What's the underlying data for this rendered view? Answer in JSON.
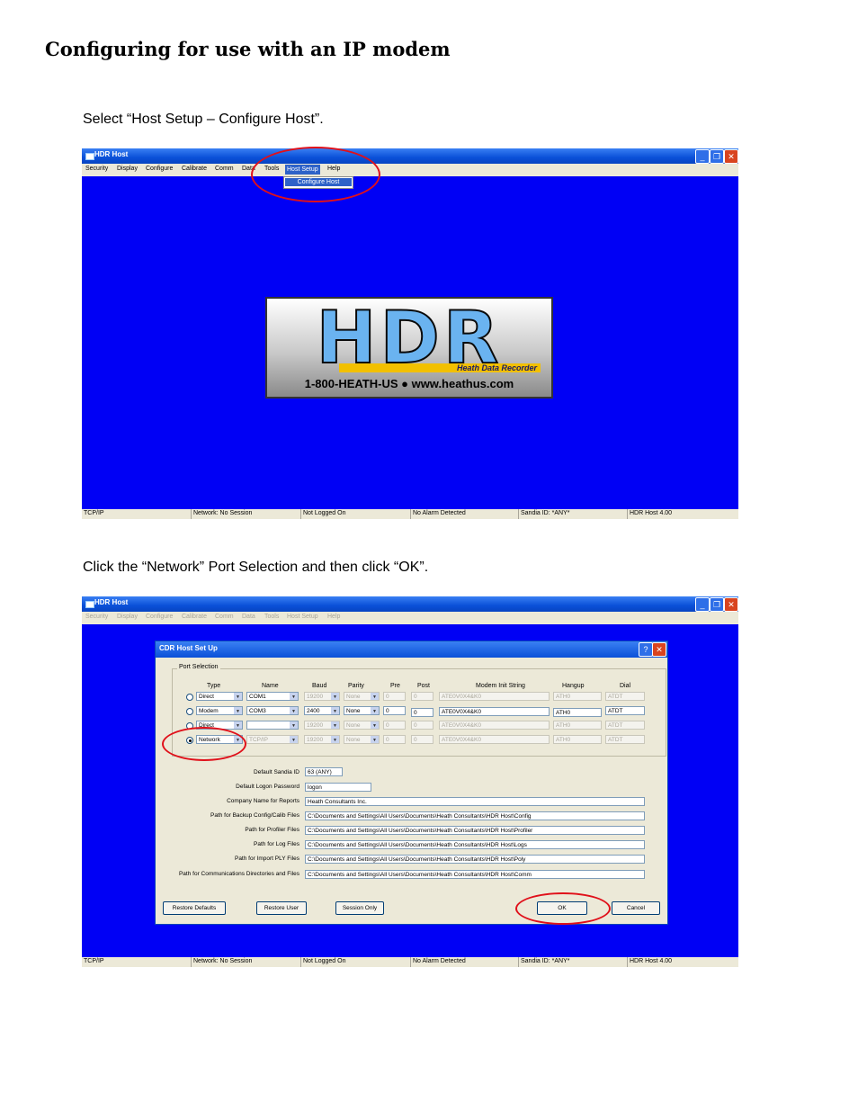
{
  "doc": {
    "title": "Configuring for use with an IP modem",
    "instruction1": "Select “Host Setup – Configure Host”.",
    "instruction2": "Click the “Network” Port Selection and then click “OK”."
  },
  "app": {
    "window_title": "HDR Host",
    "menus": [
      "Security",
      "Display",
      "Configure",
      "Calibrate",
      "Comm",
      "Data",
      "Tools",
      "Host Setup",
      "Help"
    ],
    "dropdown_item": "Configure Host",
    "status": [
      "TCP/IP",
      "Network: No Session",
      "Not Logged On",
      "No Alarm Detected",
      "Sandia ID: *ANY*",
      "HDR Host 4.00"
    ]
  },
  "logo": {
    "letters": "HDR",
    "tagline": "Heath Data Recorder",
    "contact": "1-800-HEATH-US ● www.heathus.com"
  },
  "dialog": {
    "title": "CDR Host Set Up",
    "legend": "Port Selection",
    "columns": [
      "Type",
      "Name",
      "Baud",
      "Parity",
      "Pre",
      "Post",
      "Modem Init String",
      "Hangup",
      "Dial"
    ],
    "rows": [
      {
        "type": "Direct",
        "name": "COM1",
        "baud": "19200",
        "parity": "None",
        "pre": "0",
        "post": "0",
        "init": "ATE0V0X4&K0",
        "hangup": "ATH0",
        "dial": "ATDT"
      },
      {
        "type": "Modem",
        "name": "COM3",
        "baud": "2400",
        "parity": "None",
        "pre": "0",
        "post": "0",
        "init": "ATE0V0X4&K0",
        "hangup": "ATH0",
        "dial": "ATDT"
      },
      {
        "type": "Direct",
        "name": "",
        "baud": "19200",
        "parity": "None",
        "pre": "0",
        "post": "0",
        "init": "ATE0V0X4&K0",
        "hangup": "ATH0",
        "dial": "ATDT"
      },
      {
        "type": "Network",
        "name": "TCP/IP",
        "baud": "19200",
        "parity": "None",
        "pre": "0",
        "post": "0",
        "init": "ATE0V0X4&K0",
        "hangup": "ATH0",
        "dial": "ATDT"
      }
    ],
    "fields": [
      {
        "label": "Default Sandia ID",
        "value": "63 (ANY)"
      },
      {
        "label": "Default Logon Password",
        "value": "logon"
      },
      {
        "label": "Company Name for Reports",
        "value": "Heath Consultants Inc."
      },
      {
        "label": "Path for Backup Config/Calib Files",
        "value": "C:\\Documents and Settings\\All Users\\Documents\\Heath Consultants\\HDR Host\\Config"
      },
      {
        "label": "Path for Profiler Files",
        "value": "C:\\Documents and Settings\\All Users\\Documents\\Heath Consultants\\HDR Host\\Profiler"
      },
      {
        "label": "Path for Log Files",
        "value": "C:\\Documents and Settings\\All Users\\Documents\\Heath Consultants\\HDR Host\\Logs"
      },
      {
        "label": "Path for Import PLY Files",
        "value": "C:\\Documents and Settings\\All Users\\Documents\\Heath Consultants\\HDR Host\\Poly"
      },
      {
        "label": "Path for Communications Directories and Files",
        "value": "C:\\Documents and Settings\\All Users\\Documents\\Heath Consultants\\HDR Host\\Comm"
      }
    ],
    "buttons": {
      "restore_defaults": "Restore Defaults",
      "restore_user": "Restore User",
      "session_only": "Session Only",
      "ok": "OK",
      "cancel": "Cancel"
    }
  },
  "colors": {
    "desktop_blue": "#0000f5",
    "highlight_red": "#e0101a"
  }
}
